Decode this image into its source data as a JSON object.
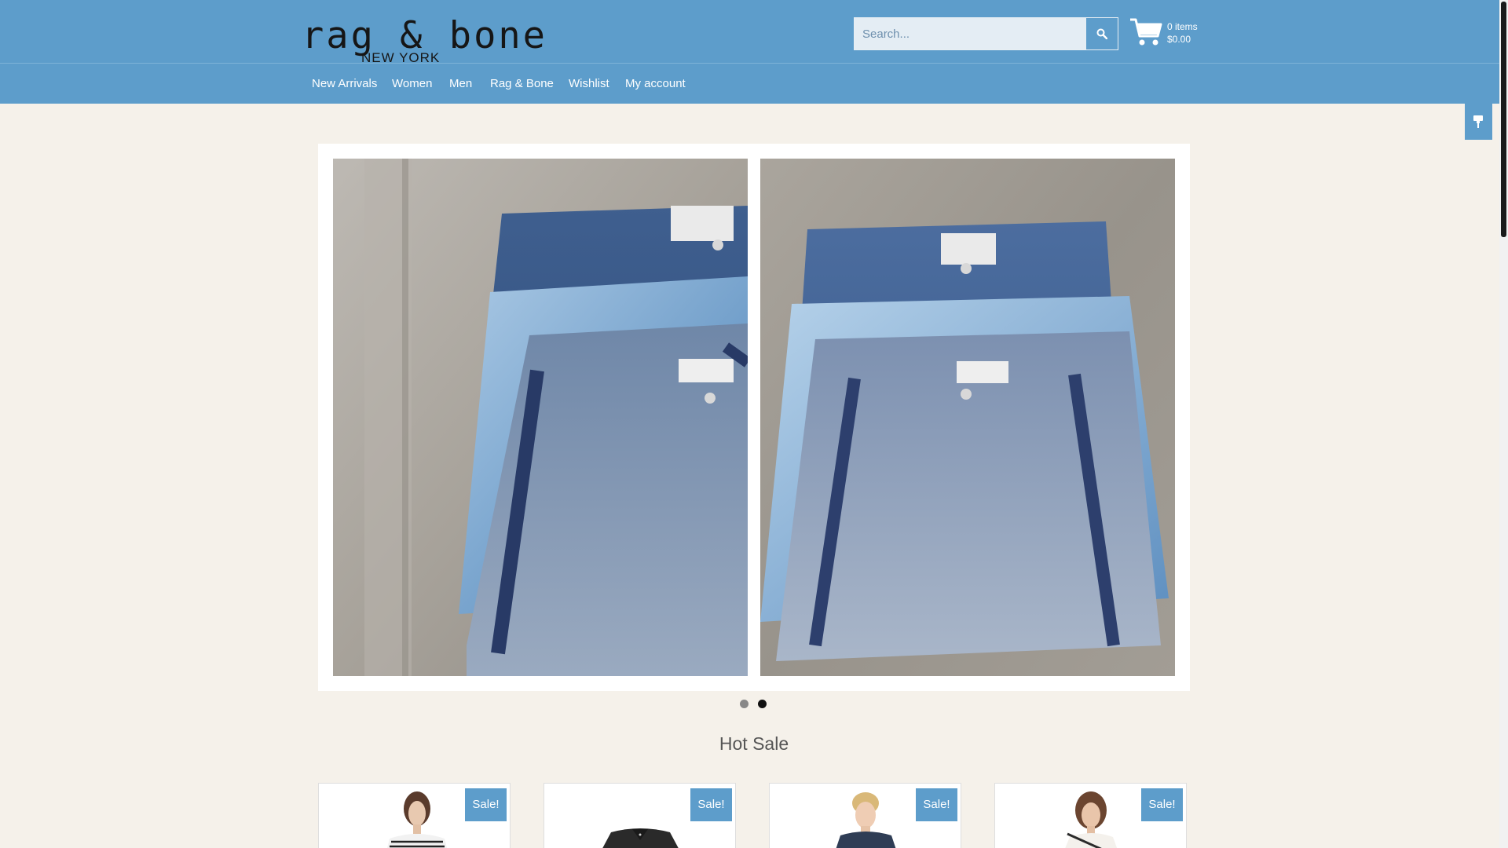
{
  "brand": {
    "name": "rag & bone",
    "location": "NEW YORK"
  },
  "search": {
    "placeholder": "Search..."
  },
  "cart": {
    "items": "0 items",
    "total": "$0.00"
  },
  "nav": [
    "New Arrivals",
    "Women",
    "Men",
    "Rag & Bone",
    "Wishlist",
    "My account"
  ],
  "slider": {
    "active_slide": 2,
    "slide_count": 2
  },
  "hot_sale": {
    "title": "Hot Sale",
    "badge": "Sale!"
  },
  "products": [
    {
      "badge": "Sale!",
      "image": "woman-striped-top"
    },
    {
      "badge": "Sale!",
      "image": "black-jacket"
    },
    {
      "badge": "Sale!",
      "image": "man-navy-shirt"
    },
    {
      "badge": "Sale!",
      "image": "woman-white-top"
    }
  ],
  "colors": {
    "header": "#5d9dcb",
    "background": "#f5f1ea",
    "sale_badge": "#5d9dcb"
  },
  "icons": [
    "search-icon",
    "shopping-cart-icon",
    "paint-brush-icon"
  ]
}
